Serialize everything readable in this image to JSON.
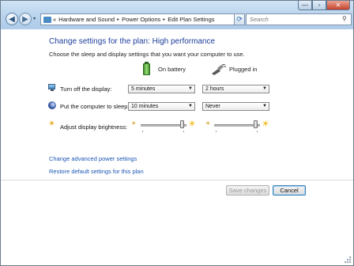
{
  "window": {
    "minimize_glyph": "—",
    "maximize_glyph": "▫",
    "close_glyph": "✕"
  },
  "nav": {
    "back_glyph": "◀",
    "forward_glyph": "▶",
    "history_glyph": "▾"
  },
  "address": {
    "prefix": "«",
    "crumbs": [
      "Hardware and Sound",
      "Power Options",
      "Edit Plan Settings"
    ],
    "separator": "▸",
    "dropdown_glyph": "▾",
    "refresh_glyph": "⟳"
  },
  "search": {
    "placeholder": "Search",
    "icon": "search-icon"
  },
  "page": {
    "heading": "Change settings for the plan: High performance",
    "subtext": "Choose the sleep and display settings that you want your computer to use."
  },
  "columns": {
    "battery": "On battery",
    "plugged": "Plugged in"
  },
  "settings": {
    "display": {
      "label": "Turn off the display:",
      "battery_value": "5 minutes",
      "plugged_value": "2 hours"
    },
    "sleep": {
      "label": "Put the computer to sleep:",
      "battery_value": "10 minutes",
      "plugged_value": "Never"
    },
    "brightness": {
      "label": "Adjust display brightness:",
      "battery_level": 0.95,
      "plugged_level": 0.95
    }
  },
  "links": {
    "advanced": "Change advanced power settings",
    "restore": "Restore default settings for this plan"
  },
  "buttons": {
    "save": "Save changes",
    "cancel": "Cancel"
  },
  "colors": {
    "heading": "#1e3e9a",
    "link": "#1a57b6",
    "titlebar": "#b9d3ec"
  }
}
